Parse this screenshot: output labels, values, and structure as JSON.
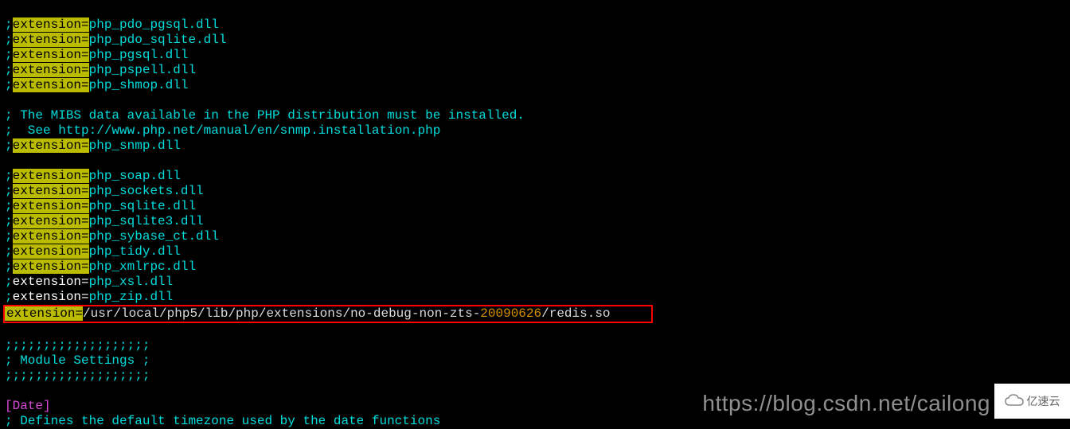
{
  "ext_label": "extension=",
  "extensions": {
    "pdo_pgsql": "php_pdo_pgsql.dll",
    "pdo_sqlite": "php_pdo_sqlite.dll",
    "pgsql": "php_pgsql.dll",
    "pspell": "php_pspell.dll",
    "shmop": "php_shmop.dll",
    "snmp": "php_snmp.dll",
    "soap": "php_soap.dll",
    "sockets": "php_sockets.dll",
    "sqlite": "php_sqlite.dll",
    "sqlite3": "php_sqlite3.dll",
    "sybase_ct": "php_sybase_ct.dll",
    "tidy": "php_tidy.dll",
    "xmlrpc": "php_xmlrpc.dll",
    "xsl": "php_xsl.dll",
    "zip": "php_zip.dll"
  },
  "redis_line": {
    "key": "extension=",
    "path_prefix": "/usr/local/php5/lib/php/extensions/no-debug-non-zts-",
    "date_num": "20090626",
    "path_suffix": "/redis.so"
  },
  "semi": ";",
  "comments": {
    "mibs": "; The MIBS data available in the PHP distribution must be installed.",
    "see_prefix": ";  See ",
    "see_url": "http://www.php.net/manual/en/snmp.installation.php",
    "divider": ";;;;;;;;;;;;;;;;;;;",
    "module_settings": "; Module Settings ;",
    "date_section": "[Date]",
    "date_desc": "; Defines the default timezone used by the date functions"
  },
  "watermark": {
    "url": "https://blog.csdn.net/cailong",
    "brand": "亿速云"
  }
}
